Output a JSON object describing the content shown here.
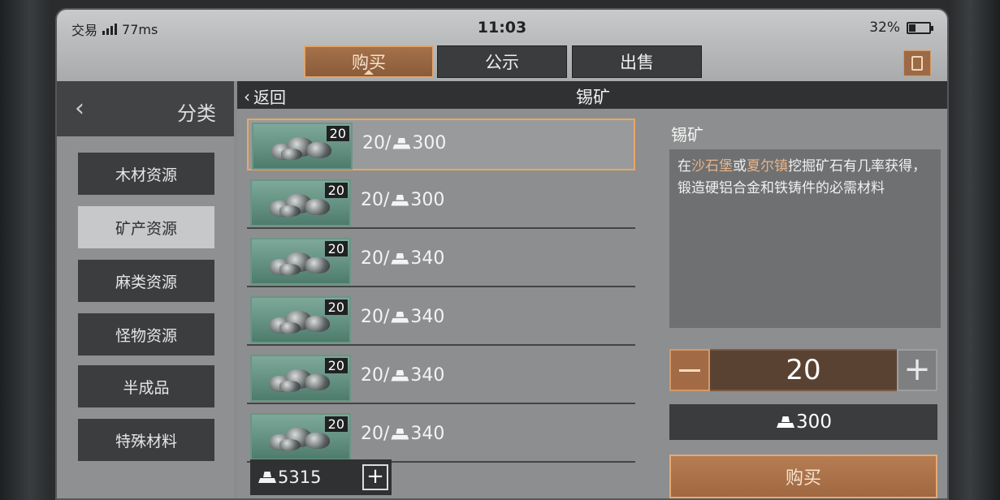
{
  "status": {
    "app": "交易",
    "ping": "77ms",
    "time": "11:03",
    "battery": "32%",
    "battery_level": 0.32
  },
  "tabs": [
    {
      "label": "购买",
      "active": true
    },
    {
      "label": "公示",
      "active": false
    },
    {
      "label": "出售",
      "active": false
    }
  ],
  "sidebar": {
    "title": "分类",
    "back_icon": "chevron-left-icon",
    "items": [
      {
        "label": "木材资源",
        "active": false
      },
      {
        "label": "矿产资源",
        "active": true
      },
      {
        "label": "麻类资源",
        "active": false
      },
      {
        "label": "怪物资源",
        "active": false
      },
      {
        "label": "半成品",
        "active": false
      },
      {
        "label": "特殊材料",
        "active": false
      }
    ]
  },
  "header": {
    "back_label": "返回",
    "title": "锡矿"
  },
  "listings": [
    {
      "qty": "20",
      "stack": "20/",
      "price": "300",
      "selected": true
    },
    {
      "qty": "20",
      "stack": "20/",
      "price": "300",
      "selected": false
    },
    {
      "qty": "20",
      "stack": "20/",
      "price": "340",
      "selected": false
    },
    {
      "qty": "20",
      "stack": "20/",
      "price": "340",
      "selected": false
    },
    {
      "qty": "20",
      "stack": "20/",
      "price": "340",
      "selected": false
    },
    {
      "qty": "20",
      "stack": "20/",
      "price": "340",
      "selected": false
    }
  ],
  "wallet": {
    "balance": "5315",
    "add_label": "+"
  },
  "detail": {
    "name": "锡矿",
    "desc_pre": "在",
    "desc_place1": "沙石堡",
    "desc_mid": "或",
    "desc_place2": "夏尔镇",
    "desc_post": "挖掘矿石有几率获得，锻造硬铝合金和铁铸件的必需材料",
    "quantity": "20",
    "plus_label": "+",
    "total": "300",
    "buy_label": "购买"
  },
  "colors": {
    "accent": "#a26b45",
    "accent_border": "#e7a766",
    "highlight_text": "#e7b489"
  }
}
